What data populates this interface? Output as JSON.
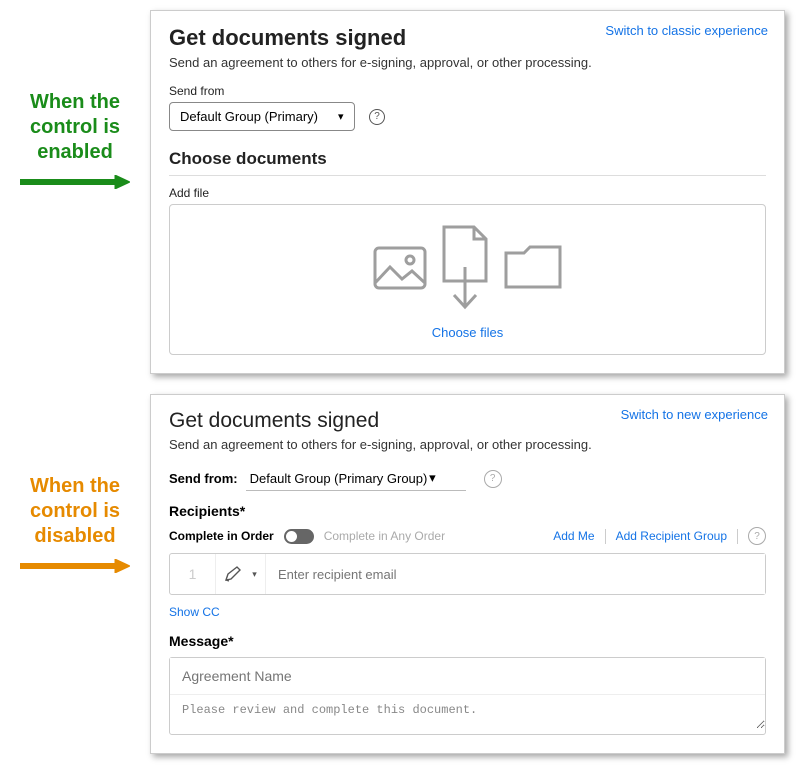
{
  "annotations": {
    "enabled": "When the control is enabled",
    "disabled": "When the control is disabled"
  },
  "panel1": {
    "title": "Get documents signed",
    "subtitle": "Send an agreement to others for e-signing, approval, or other processing.",
    "switch_link": "Switch to classic experience",
    "send_from_label": "Send from",
    "send_from_value": "Default Group (Primary)",
    "section_heading": "Choose documents",
    "add_file_label": "Add file",
    "choose_files": "Choose files"
  },
  "panel2": {
    "title": "Get documents signed",
    "subtitle": "Send an agreement to others for e-signing, approval, or other processing.",
    "switch_link": "Switch to new experience",
    "send_from_label": "Send from:",
    "send_from_value": "Default Group (Primary Group)",
    "recipients_label": "Recipients*",
    "complete_in_order": "Complete in Order",
    "complete_any_order": "Complete in Any Order",
    "add_me": "Add Me",
    "add_recipient_group": "Add Recipient Group",
    "recipient_num": "1",
    "recipient_placeholder": "Enter recipient email",
    "show_cc": "Show CC",
    "message_label": "Message*",
    "agreement_name_placeholder": "Agreement Name",
    "default_message": "Please review and complete this document."
  }
}
